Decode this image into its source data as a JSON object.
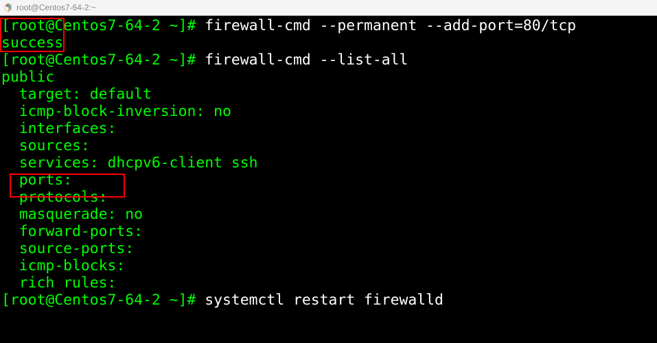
{
  "window": {
    "title": "root@Centos7-64-2:~"
  },
  "terminal": {
    "hostname": "Centos7-64-2",
    "user": "root",
    "cwd": "~",
    "prompt_symbol": "#",
    "lines": {
      "prompt1": "[root@Centos7-64-2 ~]# ",
      "cmd1": "firewall-cmd --permanent --add-port=80/tcp",
      "out_success": "success",
      "prompt2": "[root@Centos7-64-2 ~]# ",
      "cmd2": "firewall-cmd --list-all",
      "out_public": "public",
      "out_target": "  target: default",
      "out_icmp_inv": "  icmp-block-inversion: no",
      "out_interfaces": "  interfaces:",
      "out_sources": "  sources:",
      "out_services": "  services: dhcpv6-client ssh",
      "out_ports": "  ports:",
      "out_protocols": "  protocols:",
      "out_masq": "  masquerade: no",
      "out_fwd": "  forward-ports:",
      "out_srcports": "  source-ports:",
      "out_icmpblocks": "  icmp-blocks:",
      "out_rich": "  rich rules:",
      "blank": "",
      "prompt3": "[root@Centos7-64-2 ~]# ",
      "cmd3": "systemctl restart firewalld"
    }
  },
  "highlights": {
    "box1": "success",
    "box2": "ports:"
  }
}
